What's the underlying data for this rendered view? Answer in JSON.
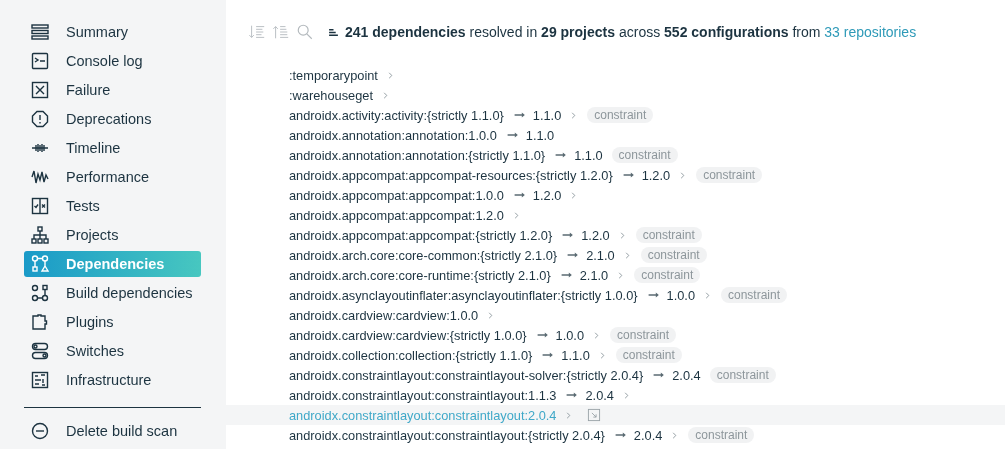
{
  "sidebar": {
    "items": [
      {
        "label": "Summary",
        "selected": false
      },
      {
        "label": "Console log",
        "selected": false
      },
      {
        "label": "Failure",
        "selected": false
      },
      {
        "label": "Deprecations",
        "selected": false
      },
      {
        "label": "Timeline",
        "selected": false
      },
      {
        "label": "Performance",
        "selected": false
      },
      {
        "label": "Tests",
        "selected": false
      },
      {
        "label": "Projects",
        "selected": false
      },
      {
        "label": "Dependencies",
        "selected": true
      },
      {
        "label": "Build dependencies",
        "selected": false
      },
      {
        "label": "Plugins",
        "selected": false
      },
      {
        "label": "Switches",
        "selected": false
      },
      {
        "label": "Infrastructure",
        "selected": false
      }
    ],
    "footer_item": {
      "label": "Delete build scan"
    }
  },
  "summary": {
    "text": "**241 dependencies** resolved in **29 projects** across **552 configurations** from",
    "link": "33 repositories"
  },
  "rows": [
    {
      "name": ":temporarypoint",
      "chevron": true,
      "selected": false
    },
    {
      "name": ":warehouseget",
      "chevron": true,
      "selected": false
    },
    {
      "name": "androidx.activity:activity:{strictly 1.1.0}",
      "resolved": "1.1.0",
      "chevron": true,
      "tag": "constraint",
      "selected": false
    },
    {
      "name": "androidx.annotation:annotation:1.0.0",
      "resolved": "1.1.0",
      "chevron": false,
      "selected": false
    },
    {
      "name": "androidx.annotation:annotation:{strictly 1.1.0}",
      "resolved": "1.1.0",
      "chevron": false,
      "tag": "constraint",
      "selected": false
    },
    {
      "name": "androidx.appcompat:appcompat-resources:{strictly 1.2.0}",
      "resolved": "1.2.0",
      "chevron": true,
      "tag": "constraint",
      "selected": false
    },
    {
      "name": "androidx.appcompat:appcompat:1.0.0",
      "resolved": "1.2.0",
      "chevron": true,
      "selected": false
    },
    {
      "name": "androidx.appcompat:appcompat:1.2.0",
      "chevron": true,
      "selected": false
    },
    {
      "name": "androidx.appcompat:appcompat:{strictly 1.2.0}",
      "resolved": "1.2.0",
      "chevron": true,
      "tag": "constraint",
      "selected": false
    },
    {
      "name": "androidx.arch.core:core-common:{strictly 2.1.0}",
      "resolved": "2.1.0",
      "chevron": true,
      "tag": "constraint",
      "selected": false
    },
    {
      "name": "androidx.arch.core:core-runtime:{strictly 2.1.0}",
      "resolved": "2.1.0",
      "chevron": true,
      "tag": "constraint",
      "selected": false
    },
    {
      "name": "androidx.asynclayoutinflater:asynclayoutinflater:{strictly 1.0.0}",
      "resolved": "1.0.0",
      "chevron": true,
      "tag": "constraint",
      "selected": false
    },
    {
      "name": "androidx.cardview:cardview:1.0.0",
      "chevron": true,
      "selected": false
    },
    {
      "name": "androidx.cardview:cardview:{strictly 1.0.0}",
      "resolved": "1.0.0",
      "chevron": true,
      "tag": "constraint",
      "selected": false
    },
    {
      "name": "androidx.collection:collection:{strictly 1.1.0}",
      "resolved": "1.1.0",
      "chevron": true,
      "tag": "constraint",
      "selected": false
    },
    {
      "name": "androidx.constraintlayout:constraintlayout-solver:{strictly 2.0.4}",
      "resolved": "2.0.4",
      "chevron": false,
      "tag": "constraint",
      "selected": false
    },
    {
      "name": "androidx.constraintlayout:constraintlayout:1.1.3",
      "resolved": "2.0.4",
      "chevron": true,
      "selected": false
    },
    {
      "name": "androidx.constraintlayout:constraintlayout:2.0.4",
      "chevron": true,
      "selected": true
    },
    {
      "name": "androidx.constraintlayout:constraintlayout:{strictly 2.0.4}",
      "resolved": "2.0.4",
      "chevron": true,
      "tag": "constraint",
      "selected": false
    }
  ]
}
